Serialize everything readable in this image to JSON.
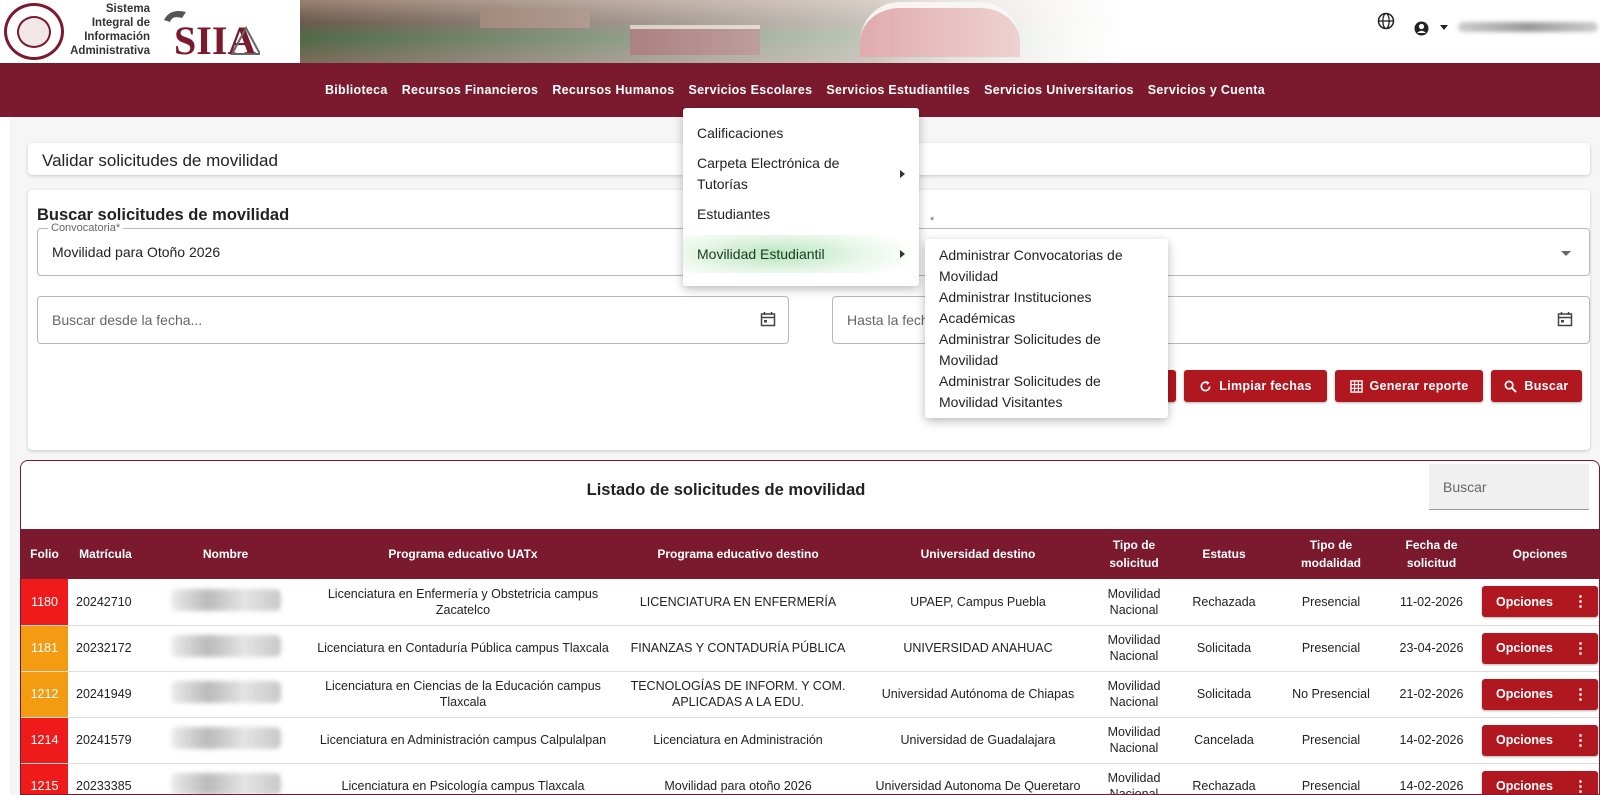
{
  "header": {
    "system_name_lines": [
      "Sistema",
      "Integral de",
      "Información",
      "Administrativa"
    ],
    "logo_text": "SIIA",
    "user_name": "usuario"
  },
  "navbar": {
    "items": [
      {
        "label": "Biblioteca"
      },
      {
        "label": "Recursos Financieros"
      },
      {
        "label": "Recursos Humanos"
      },
      {
        "label": "Servicios Escolares"
      },
      {
        "label": "Servicios Estudiantiles"
      },
      {
        "label": "Servicios Universitarios"
      },
      {
        "label": "Servicios y Cuenta"
      }
    ]
  },
  "page": {
    "title": "Validar solicitudes de movilidad"
  },
  "search": {
    "title": "Buscar solicitudes de movilidad",
    "convocatoria_label": "Convocatoria*",
    "convocatoria_value": "Movilidad para Otoño 2026",
    "second_select_label": "*",
    "desde_placeholder": "Buscar desde la fecha...",
    "hasta_placeholder": "Hasta la fecha...",
    "buttons": {
      "limpiar": "Limpiar fechas",
      "reporte": "Generar reporte",
      "buscar": "Buscar"
    }
  },
  "list": {
    "title": "Listado de solicitudes de movilidad",
    "search_placeholder": "Buscar",
    "columns": [
      "Folio",
      "Matrícula",
      "Nombre",
      "Programa educativo UATx",
      "Programa educativo destino",
      "Universidad destino",
      "Tipo de solicitud",
      "Estatus",
      "Tipo de modalidad",
      "Fecha de solicitud",
      "Opciones"
    ],
    "rows": [
      {
        "folio": "1180",
        "folio_color": "#ef1b1b",
        "matricula": "20242710",
        "nombre": "",
        "programa_uatx": "Licenciatura en Enfermería y Obstetricia campus Zacatelco",
        "programa_destino": "LICENCIATURA EN ENFERMERÍA",
        "universidad": "UPAEP, Campus Puebla",
        "tipo": "Movilidad Nacional",
        "estatus": "Rechazada",
        "modalidad": "Presencial",
        "fecha": "11-02-2026",
        "opciones": "Opciones"
      },
      {
        "folio": "1181",
        "folio_color": "#f39c12",
        "matricula": "20232172",
        "nombre": "",
        "programa_uatx": "Licenciatura en Contaduría Pública campus Tlaxcala",
        "programa_destino": "FINANZAS Y CONTADURÍA PÚBLICA",
        "universidad": "UNIVERSIDAD ANAHUAC",
        "tipo": "Movilidad Nacional",
        "estatus": "Solicitada",
        "modalidad": "Presencial",
        "fecha": "23-04-2026",
        "opciones": "Opciones"
      },
      {
        "folio": "1212",
        "folio_color": "#f39c12",
        "matricula": "20241949",
        "nombre": "",
        "programa_uatx": "Licenciatura en Ciencias de la Educación campus Tlaxcala",
        "programa_destino": "TECNOLOGÍAS DE INFORM. Y COM. APLICADAS A LA EDU.",
        "universidad": "Universidad Autónoma de Chiapas",
        "tipo": "Movilidad Nacional",
        "estatus": "Solicitada",
        "modalidad": "No Presencial",
        "fecha": "21-02-2026",
        "opciones": "Opciones"
      },
      {
        "folio": "1214",
        "folio_color": "#ef1b1b",
        "matricula": "20241579",
        "nombre": "",
        "programa_uatx": "Licenciatura en Administración campus Calpulalpan",
        "programa_destino": "Licenciatura en Administración",
        "universidad": "Universidad de Guadalajara",
        "tipo": "Movilidad Nacional",
        "estatus": "Cancelada",
        "modalidad": "Presencial",
        "fecha": "14-02-2026",
        "opciones": "Opciones"
      },
      {
        "folio": "1215",
        "folio_color": "#ef1b1b",
        "matricula": "20233385",
        "nombre": "",
        "programa_uatx": "Licenciatura en Psicología campus Tlaxcala",
        "programa_destino": "Movilidad para otoño 2026",
        "universidad": "Universidad Autonoma De Queretaro",
        "tipo": "Movilidad Nacional",
        "estatus": "Rechazada",
        "modalidad": "Presencial",
        "fecha": "14-02-2026",
        "opciones": "Opciones"
      }
    ]
  },
  "dropdown_menu": {
    "items": [
      {
        "label": "Calificaciones"
      },
      {
        "label": "Carpeta Electrónica de Tutorías"
      },
      {
        "label": "Estudiantes"
      },
      {
        "label": "Movilidad Estudiantil"
      }
    ]
  },
  "submenu": {
    "items": [
      {
        "label": "Administrar Convocatorias de Movilidad"
      },
      {
        "label": "Administrar Instituciones Académicas"
      },
      {
        "label": "Administrar Solicitudes de Movilidad"
      },
      {
        "label": "Administrar Solicitudes de Movilidad Visitantes"
      }
    ]
  },
  "colors": {
    "brand": "#7b1a2e",
    "button": "#b0171f",
    "folio_red": "#ef1b1b",
    "folio_orange": "#f39c12"
  }
}
